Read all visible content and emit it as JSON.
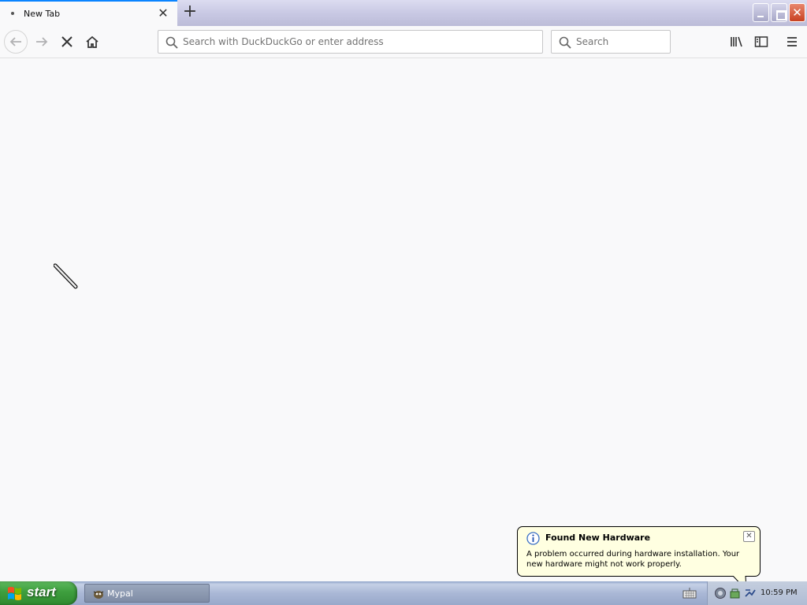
{
  "browser": {
    "tab": {
      "title": "New Tab"
    },
    "urlbar": {
      "placeholder": "Search with DuckDuckGo or enter address"
    },
    "searchbar": {
      "placeholder": "Search"
    }
  },
  "balloon": {
    "title": "Found New Hardware",
    "message": "A problem occurred during hardware installation. Your new hardware might not work properly."
  },
  "taskbar": {
    "start_label": "start",
    "task_label": "Mypal",
    "clock": "10:59 PM"
  },
  "colors": {
    "accent": "#0a84ff",
    "balloon_bg": "#ffffe1",
    "start_green": "#3e9e3e"
  }
}
